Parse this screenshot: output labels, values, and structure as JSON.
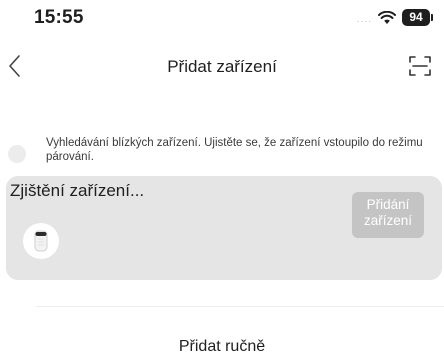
{
  "status_bar": {
    "time": "15:55",
    "signal": "....",
    "battery": "94"
  },
  "nav": {
    "title": "Přidat zařízení"
  },
  "hint": {
    "text": "Vyhledávání blízkých zařízení. Ujistěte se, že zařízení vstoupilo do režimu párování."
  },
  "card": {
    "title": "Zjištění zařízení...",
    "add_button": "Přidání zařízení"
  },
  "manual": {
    "label": "Přidat ručně"
  },
  "colors": {
    "card_bg": "#e5e5e5",
    "button_bg": "#c4c4c4"
  }
}
